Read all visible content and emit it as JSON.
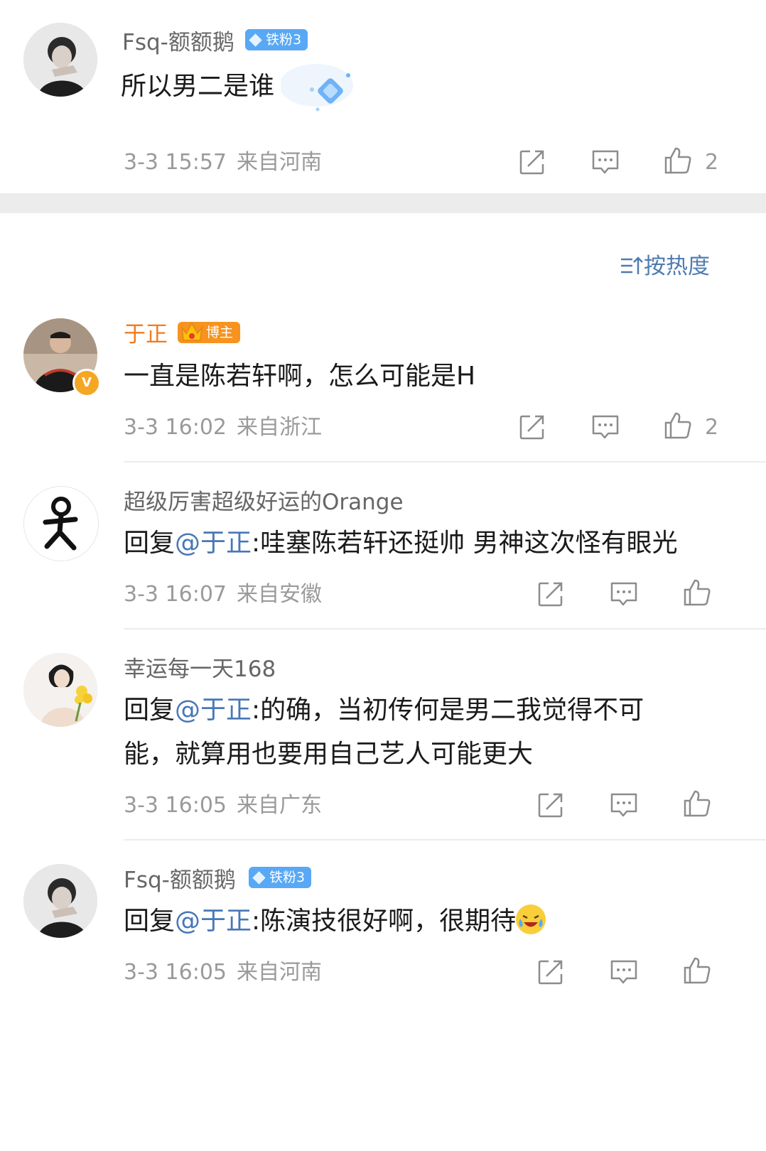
{
  "comment_main": {
    "user": "Fsq-额额鹅",
    "badge": "铁粉3",
    "text": "所以男二是谁",
    "time": "3-3 15:57",
    "location": "来自河南",
    "likes": "2"
  },
  "sort_label": "按热度",
  "replies": [
    {
      "user": "于正",
      "badge": "博主",
      "text": "一直是陈若轩啊，怎么可能是H",
      "time": "3-3 16:02",
      "location": "来自浙江",
      "likes": "2"
    },
    {
      "user": "超级厉害超级好运的Orange",
      "reply_prefix": "回复",
      "mention": "@于正",
      "text": ":哇塞陈若轩还挺帅 男神这次怪有眼光",
      "time": "3-3 16:07",
      "location": "来自安徽"
    },
    {
      "user": "幸运每一天168",
      "reply_prefix": "回复",
      "mention": "@于正",
      "text_line1": ":的确，当初传何是男二我觉得不可",
      "text_line2": "能，就算用也要用自己艺人可能更大",
      "time": "3-3 16:05",
      "location": "来自广东"
    },
    {
      "user": "Fsq-额额鹅",
      "badge": "铁粉3",
      "reply_prefix": "回复",
      "mention": "@于正",
      "text": ":陈演技很好啊，很期待",
      "time": "3-3 16:05",
      "location": "来自河南"
    }
  ],
  "colors": {
    "mention": "#4877b8",
    "highlight_name": "#f07c1e",
    "fan_badge": "#58a8f5",
    "blogger_badge": "#f7931e",
    "meta": "#9a9a9a"
  },
  "icons": [
    "share-icon",
    "comment-icon",
    "like-icon",
    "sort-icon",
    "verified-icon"
  ]
}
